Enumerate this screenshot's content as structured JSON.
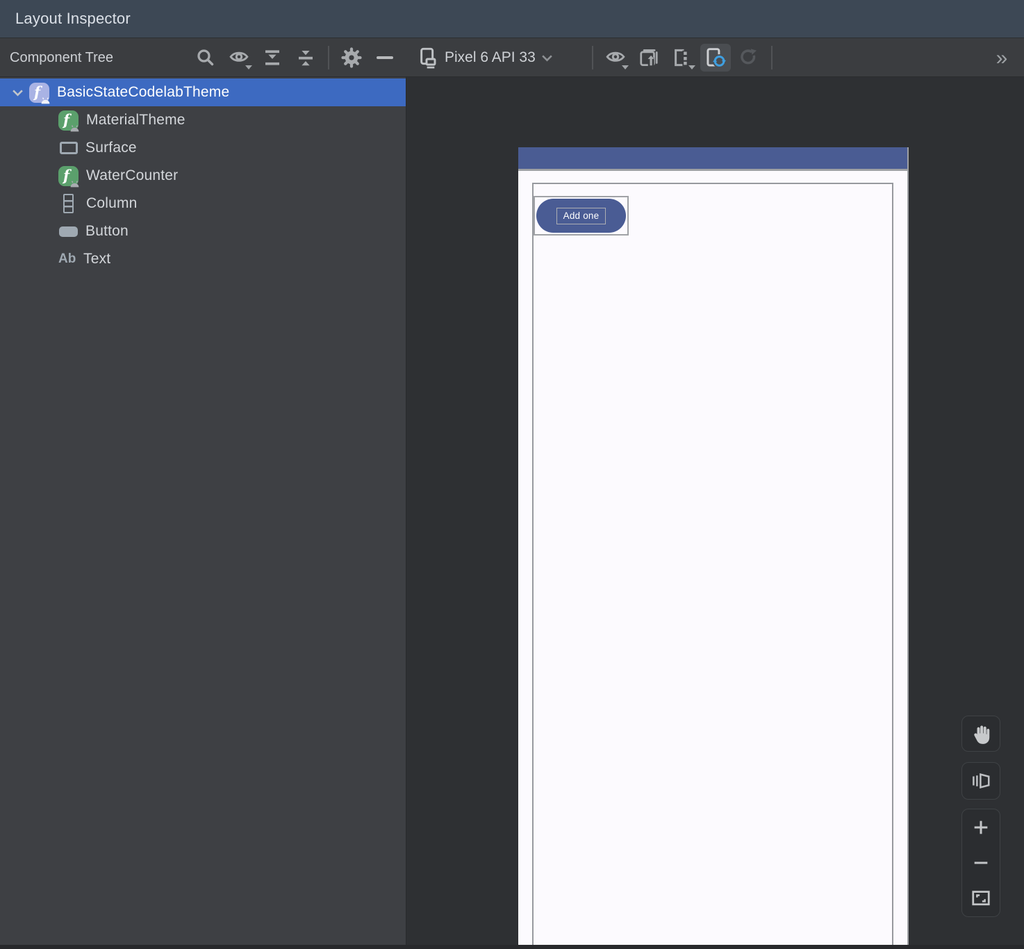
{
  "window": {
    "title": "Layout Inspector"
  },
  "toolbar": {
    "panel_label": "Component Tree",
    "tree_actions": [
      "search-icon",
      "visibility-icon",
      "expand-all-icon",
      "collapse-all-icon",
      "settings-gear-icon",
      "hide-icon"
    ],
    "device_selector": {
      "label": "Pixel 6 API 33",
      "icon": "device-phone-icon"
    },
    "view_actions": [
      "view-options-eye-icon",
      "capture-screenshot-icon",
      "export-snapshot-icon",
      "live-updates-icon",
      "refresh-icon"
    ],
    "live_updates_active": true,
    "overflow_label": "»"
  },
  "tree": {
    "items": [
      {
        "label": "BasicStateCodelabTheme",
        "icon": "compose-function-icon",
        "selected": true,
        "expanded": true
      },
      {
        "label": "MaterialTheme",
        "icon": "compose-function-icon"
      },
      {
        "label": "Surface",
        "icon": "surface-icon"
      },
      {
        "label": "WaterCounter",
        "icon": "compose-function-icon"
      },
      {
        "label": "Column",
        "icon": "column-icon"
      },
      {
        "label": "Button",
        "icon": "button-icon"
      },
      {
        "label": "Text",
        "icon": "text-icon"
      }
    ]
  },
  "icons": {
    "compose_glyph": "f",
    "text_glyph": "Ab"
  },
  "preview": {
    "button_label": "Add one"
  },
  "zoom_controls": [
    "pan-hand-icon",
    "3d-mode-icon",
    "zoom-in-icon",
    "zoom-out-icon",
    "zoom-to-fit-icon"
  ],
  "colors": {
    "selection_blue": "#3D6AC1",
    "compose_icon_green": "#5BA06C",
    "compose_icon_lavender": "#A9B3E4",
    "device_bar_blue": "#4A5C93",
    "device_surface": "#FCFAFE",
    "live_updates_accent": "#3F9FE0",
    "titlebar": "#3D4855",
    "toolbar": "#3B3D40",
    "tree_panel": "#3E4044",
    "canvas": "#2E3033"
  }
}
